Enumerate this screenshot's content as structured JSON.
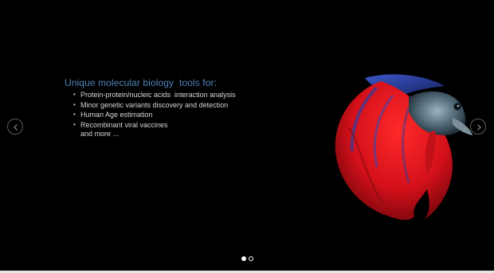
{
  "slide": {
    "headline": "Unique molecular biology  tools for:",
    "tools": [
      "Protein-protein/nucleic acids  interaction analysis",
      "Minor genetic variants discovery and detection",
      "Human Age estimation",
      "Recombinant viral vaccines"
    ],
    "more": "and more ...",
    "bullet_glyph": "•",
    "image_icon": "betta-fish-illustration"
  },
  "navigation": {
    "prev_icon": "chevron-left-icon",
    "next_icon": "chevron-right-icon"
  },
  "pagination": {
    "total_slides": 2,
    "active_slide": 1
  },
  "colors": {
    "background": "#000000",
    "headline": "#4f83b8",
    "body_text": "#d6d6d6",
    "fish_red": "#e0141c",
    "fish_blue": "#2b3f9e"
  }
}
